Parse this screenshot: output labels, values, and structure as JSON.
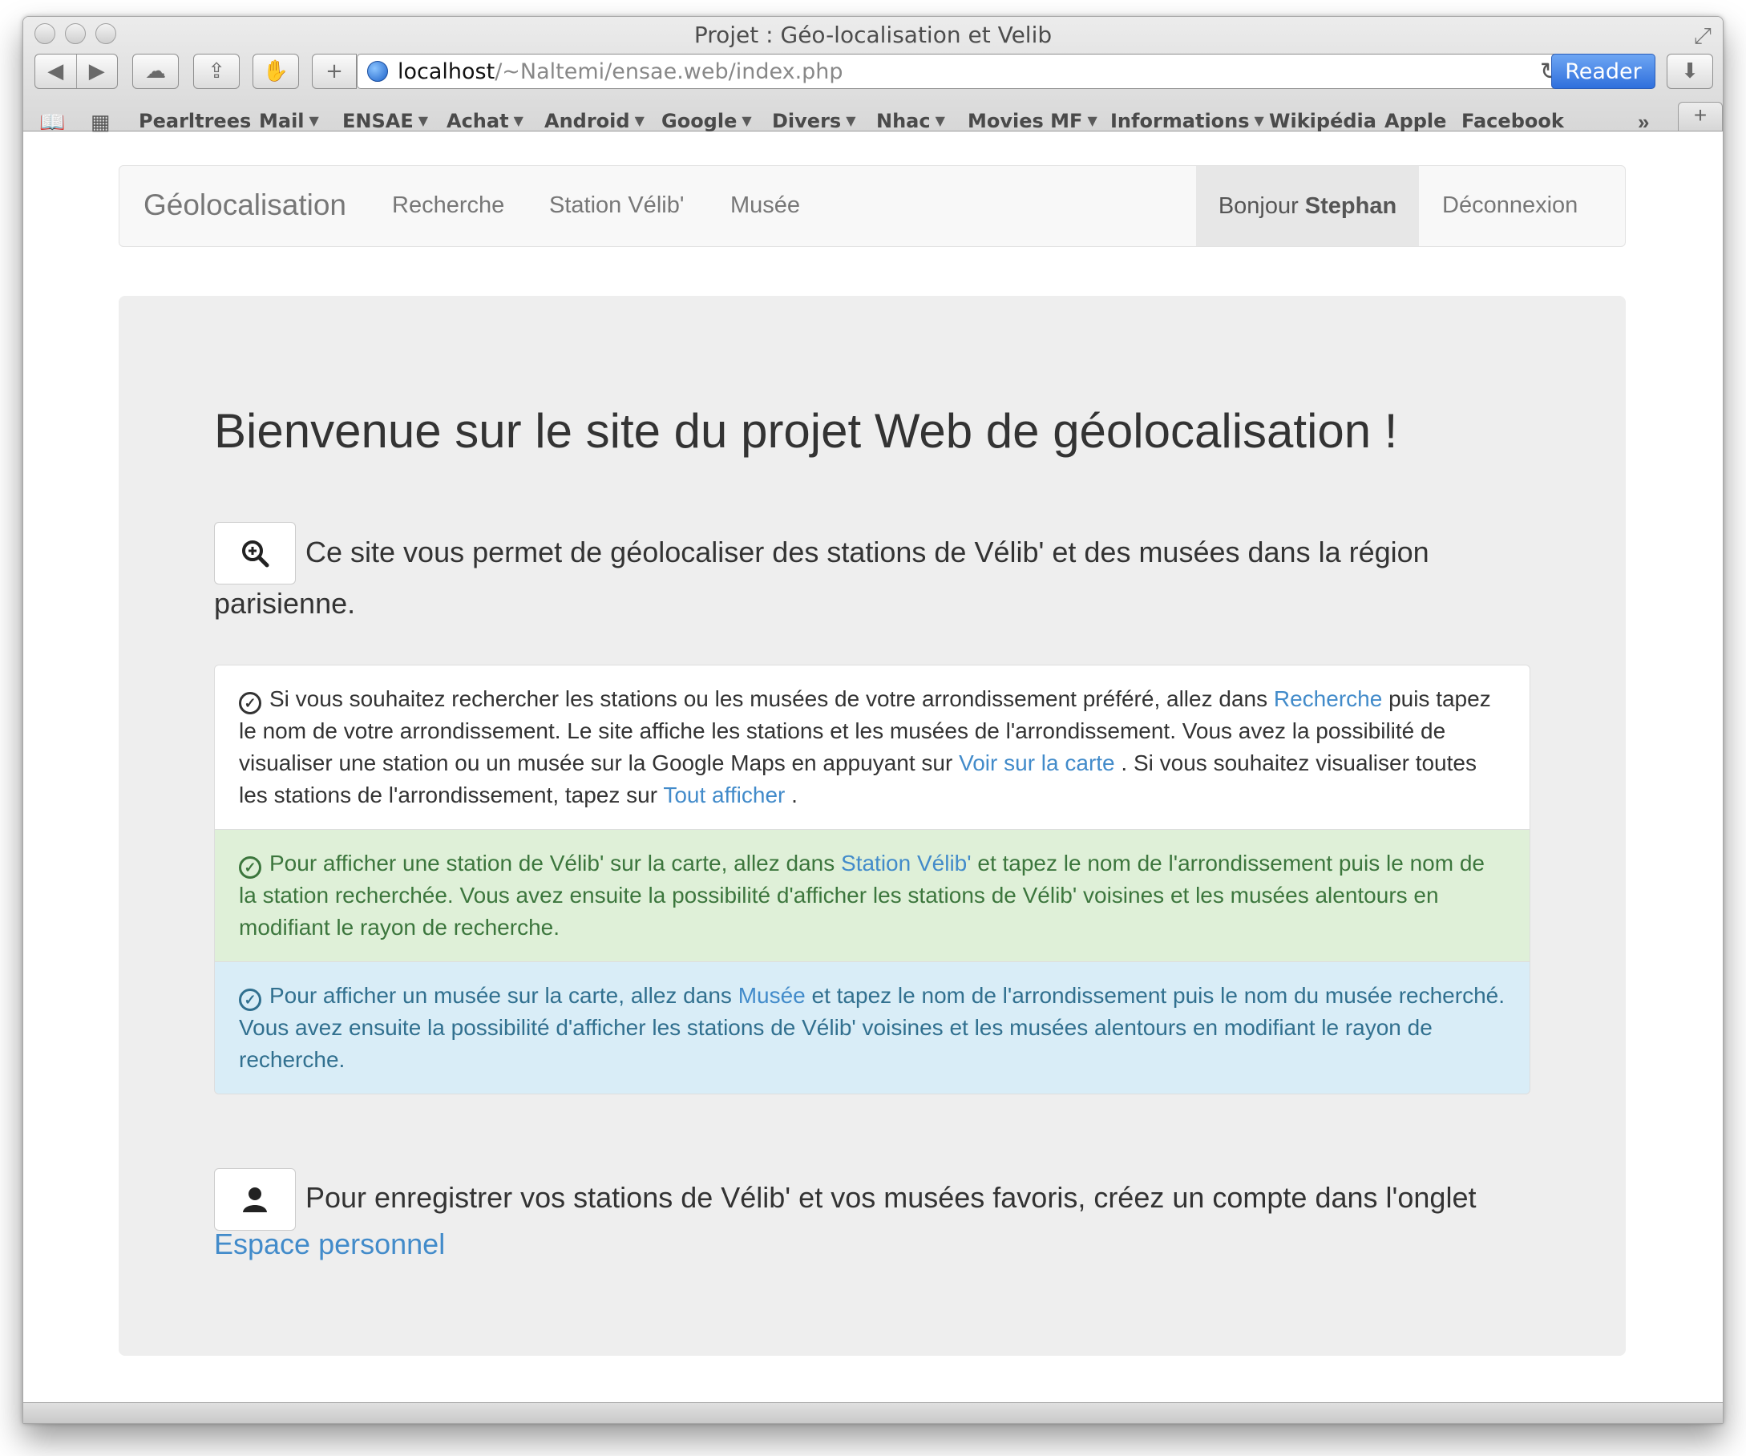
{
  "browser": {
    "title": "Projet : Géo-localisation et Velib",
    "url_host": "localhost",
    "url_path": "/~Naltemi/ensae.web/index.php",
    "reader_label": "Reader",
    "bookmarks": [
      {
        "label": "Pearltrees",
        "menu": false
      },
      {
        "label": "Mail",
        "menu": true
      },
      {
        "label": "ENSAE",
        "menu": true
      },
      {
        "label": "Achat",
        "menu": true
      },
      {
        "label": "Android",
        "menu": true
      },
      {
        "label": "Google",
        "menu": true
      },
      {
        "label": "Divers",
        "menu": true
      },
      {
        "label": "Nhac",
        "menu": true
      },
      {
        "label": "Movies MF",
        "menu": true
      },
      {
        "label": "Informations",
        "menu": true
      },
      {
        "label": "Wikipédia",
        "menu": false
      },
      {
        "label": "Apple",
        "menu": false
      },
      {
        "label": "Facebook",
        "menu": false
      }
    ],
    "icons": [
      "back-icon",
      "forward-icon",
      "icloud-icon",
      "share-icon",
      "block-icon",
      "add-icon",
      "globe-icon",
      "reload-icon",
      "download-icon",
      "reading-list-icon",
      "top-sites-icon",
      "overflow-icon",
      "new-tab-icon"
    ]
  },
  "navbar": {
    "brand": "Géolocalisation",
    "links": [
      "Recherche",
      "Station Vélib'",
      "Musée"
    ],
    "greeting": "Bonjour",
    "user": "Stephan",
    "logout": "Déconnexion"
  },
  "main": {
    "headline": "Bienvenue sur le site du projet Web de géolocalisation !",
    "intro_line1": "Ce site vous permet de géolocaliser des stations de Vélib' et des musées dans la région",
    "intro_line2": "parisienne.",
    "items": [
      {
        "type": "default",
        "p1": "Si vous souhaitez rechercher les stations ou les musées de votre arrondissement préféré, allez dans",
        "link1": "Recherche",
        "p2": "puis tapez le nom de votre arrondissement. Le site affiche les stations et les musées de l'arrondissement. Vous avez la possibilité de visualiser une station ou un musée sur la Google Maps en appuyant sur",
        "link2": "Voir sur la carte",
        "p3": ". Si vous souhaitez visualiser toutes les stations de l'arrondissement, tapez sur",
        "link3": "Tout afficher",
        "p4": "."
      },
      {
        "type": "success",
        "p1": "Pour afficher une station de Vélib' sur la carte, allez dans",
        "link1": "Station Vélib'",
        "p2": "et tapez le nom de l'arrondissement puis le nom de la station recherchée. Vous avez ensuite la possibilité d'afficher les stations de Vélib' voisines et les musées alentours en modifiant le rayon de recherche."
      },
      {
        "type": "info",
        "p1": "Pour afficher un musée sur la carte, allez dans",
        "link1": "Musée",
        "p2": "et tapez le nom de l'arrondissement puis le nom du musée recherché. Vous avez ensuite la possibilité d'afficher les stations de Vélib' voisines et les musées alentours en modifiant le rayon de recherche."
      }
    ],
    "account_text": "Pour enregistrer vos stations de Vélib' et vos musées favoris, créez un compte dans l'onglet",
    "account_link": "Espace personnel"
  },
  "colors": {
    "link": "#428bca",
    "success_bg": "#dff0d8",
    "success_text": "#3c763d",
    "info_bg": "#d9edf7",
    "info_text": "#31708f",
    "jumbotron_bg": "#eeeeee"
  }
}
